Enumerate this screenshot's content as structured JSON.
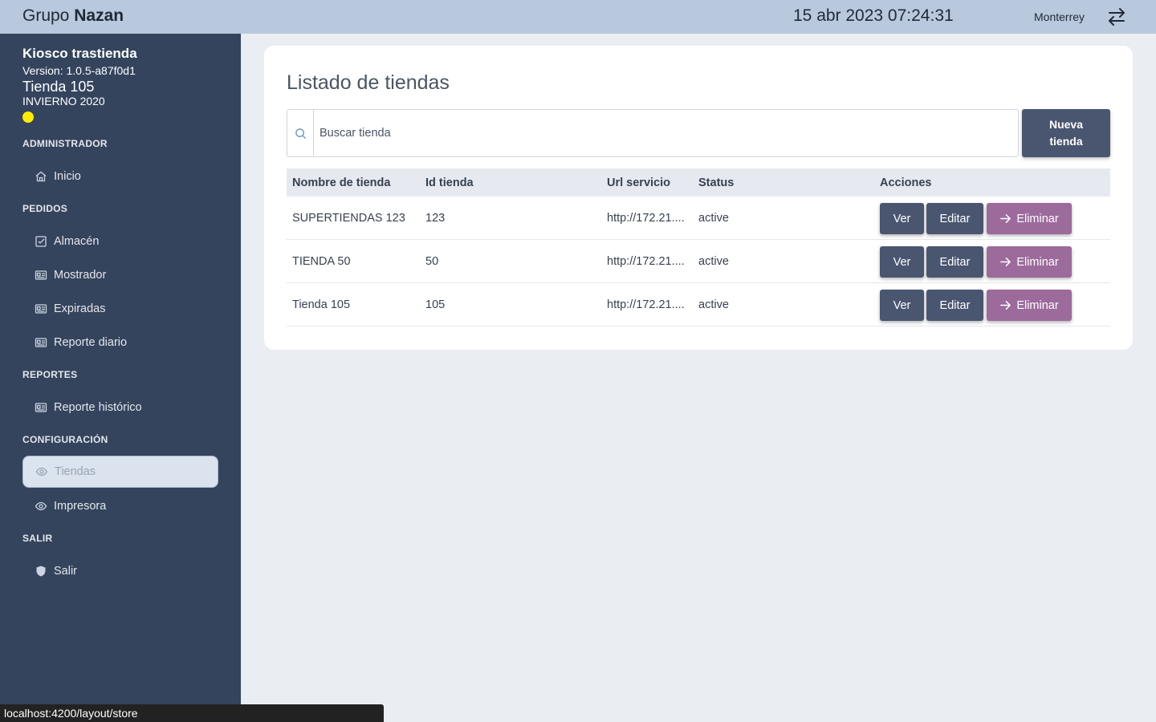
{
  "topbar": {
    "brand_regular": "Grupo",
    "brand_bold": "Nazan",
    "datetime": "15 abr 2023 07:24:31",
    "city": "Monterrey"
  },
  "sidebar": {
    "app_name": "Kiosco trastienda",
    "version": "Version: 1.0.5-a87f0d1",
    "store": "Tienda 105",
    "season": "INVIERNO 2020",
    "status_color": "#ffec00",
    "sections": [
      {
        "title": "ADMINISTRADOR",
        "items": [
          {
            "label": "Inicio",
            "icon": "home-icon"
          }
        ]
      },
      {
        "title": "PEDIDOS",
        "items": [
          {
            "label": "Almacén",
            "icon": "checkbox-icon"
          },
          {
            "label": "Mostrador",
            "icon": "id-card-icon"
          },
          {
            "label": "Expiradas",
            "icon": "id-card-icon"
          },
          {
            "label": "Reporte diario",
            "icon": "id-card-icon"
          }
        ]
      },
      {
        "title": "REPORTES",
        "items": [
          {
            "label": "Reporte histórico",
            "icon": "id-card-icon"
          }
        ]
      },
      {
        "title": "CONFIGURACIÓN",
        "items": [
          {
            "label": "Tiendas",
            "icon": "eye-icon",
            "active": true
          },
          {
            "label": "Impresora",
            "icon": "eye-icon"
          }
        ]
      },
      {
        "title": "SALIR",
        "items": [
          {
            "label": "Salir",
            "icon": "shield-icon"
          }
        ]
      }
    ]
  },
  "main": {
    "title": "Listado de tiendas",
    "search_placeholder": "Buscar tienda",
    "new_button": "Nueva tienda",
    "columns": [
      "Nombre de tienda",
      "Id tienda",
      "Url servicio",
      "Status",
      "Acciones"
    ],
    "rows": [
      {
        "name": "SUPERTIENDAS 123",
        "id": "123",
        "url": "http://172.21....",
        "status": "active"
      },
      {
        "name": "TIENDA 50",
        "id": "50",
        "url": "http://172.21....",
        "status": "active"
      },
      {
        "name": "Tienda 105",
        "id": "105",
        "url": "http://172.21....",
        "status": "active"
      }
    ],
    "actions": {
      "view": "Ver",
      "edit": "Editar",
      "delete": "Eliminar"
    }
  },
  "statusbar": {
    "url": "localhost:4200/layout/store"
  },
  "colors": {
    "topbar": "#b8c9dd",
    "sidebar": "#34445d",
    "primary_button": "#4a5670",
    "delete_button": "#9c6b9c"
  }
}
